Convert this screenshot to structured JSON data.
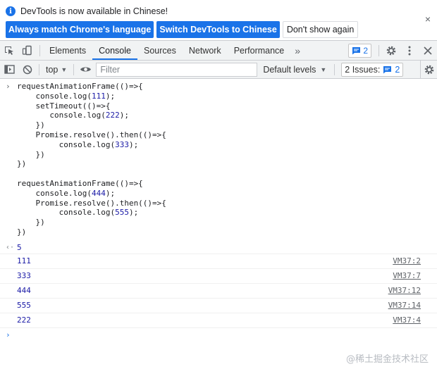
{
  "infobar": {
    "message": "DevTools is now available in Chinese!",
    "buttons": {
      "match_language": "Always match Chrome's language",
      "switch_chinese": "Switch DevTools to Chinese",
      "dont_show": "Don't show again"
    },
    "close_glyph": "×"
  },
  "tabbar": {
    "tabs": [
      "Elements",
      "Console",
      "Sources",
      "Network",
      "Performance"
    ],
    "active_tab": "Console",
    "more_glyph": "»",
    "messages_count": "2"
  },
  "console_toolbar": {
    "context": "top",
    "filter_placeholder": "Filter",
    "levels_label": "Default levels",
    "issues_label": "2 Issues:",
    "issues_count": "2"
  },
  "console": {
    "input_code_lines": [
      "requestAnimationFrame(()=>{",
      "    console.log(111);",
      "    setTimeout(()=>{",
      "       console.log(222);",
      "    })",
      "    Promise.resolve().then(()=>{",
      "         console.log(333);",
      "    })",
      "})",
      "",
      "requestAnimationFrame(()=>{",
      "    console.log(444);",
      "    Promise.resolve().then(()=>{",
      "         console.log(555);",
      "    })",
      "})"
    ],
    "return_value": "5",
    "logs": [
      {
        "value": "111",
        "source": "VM37:2"
      },
      {
        "value": "333",
        "source": "VM37:7"
      },
      {
        "value": "444",
        "source": "VM37:12"
      },
      {
        "value": "555",
        "source": "VM37:14"
      },
      {
        "value": "222",
        "source": "VM37:4"
      }
    ]
  },
  "watermark": "@稀土掘金技术社区",
  "colors": {
    "accent": "#1a73e8",
    "number_literal": "#1a1aa6",
    "toolbar_bg": "#f1f3f4"
  }
}
